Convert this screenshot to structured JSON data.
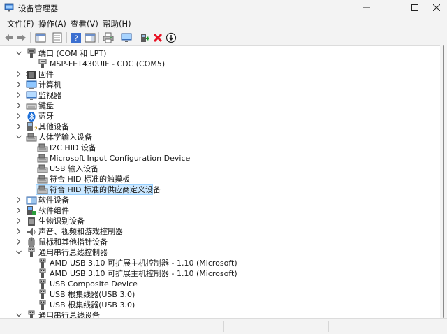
{
  "window": {
    "title": "设备管理器"
  },
  "menu": {
    "items": [
      "文件(F)",
      "操作(A)",
      "查看(V)",
      "帮助(H)"
    ]
  },
  "toolbar": {
    "buttons": [
      "back-icon",
      "forward-icon",
      "show-hide-tree-icon",
      "properties-icon",
      "help-icon",
      "action-pane-icon",
      "print-icon",
      "monitor-icon",
      "add-driver-icon",
      "uninstall-icon",
      "update-driver-icon"
    ]
  },
  "tree": {
    "rows": [
      {
        "label": "端口 (COM 和 LPT)",
        "level": 1,
        "expander": "expanded",
        "icon": "port-icon"
      },
      {
        "label": "MSP-FET430UIF - CDC (COM5)",
        "level": 2,
        "expander": "none",
        "icon": "port-icon"
      },
      {
        "label": "固件",
        "level": 1,
        "expander": "collapsed",
        "icon": "firmware-icon"
      },
      {
        "label": "计算机",
        "level": 1,
        "expander": "collapsed",
        "icon": "computer-icon"
      },
      {
        "label": "监视器",
        "level": 1,
        "expander": "collapsed",
        "icon": "monitor-icon"
      },
      {
        "label": "键盘",
        "level": 1,
        "expander": "collapsed",
        "icon": "keyboard-icon"
      },
      {
        "label": "蓝牙",
        "level": 1,
        "expander": "collapsed",
        "icon": "bluetooth-icon"
      },
      {
        "label": "其他设备",
        "level": 1,
        "expander": "collapsed",
        "icon": "unknown-device-icon"
      },
      {
        "label": "人体学输入设备",
        "level": 1,
        "expander": "expanded",
        "icon": "hid-icon"
      },
      {
        "label": "I2C HID 设备",
        "level": 2,
        "expander": "none",
        "icon": "hid-icon"
      },
      {
        "label": "Microsoft Input Configuration Device",
        "level": 2,
        "expander": "none",
        "icon": "hid-icon"
      },
      {
        "label": "USB 输入设备",
        "level": 2,
        "expander": "none",
        "icon": "hid-icon"
      },
      {
        "label": "符合 HID 标准的触摸板",
        "level": 2,
        "expander": "none",
        "icon": "hid-icon"
      },
      {
        "label": "符合 HID 标准的供应商定义设备",
        "level": 2,
        "expander": "none",
        "icon": "hid-icon",
        "selected": true
      },
      {
        "label": "软件设备",
        "level": 1,
        "expander": "collapsed",
        "icon": "software-device-icon"
      },
      {
        "label": "软件组件",
        "level": 1,
        "expander": "collapsed",
        "icon": "software-component-icon"
      },
      {
        "label": "生物识别设备",
        "level": 1,
        "expander": "collapsed",
        "icon": "biometric-icon"
      },
      {
        "label": "声音、视频和游戏控制器",
        "level": 1,
        "expander": "collapsed",
        "icon": "speaker-icon"
      },
      {
        "label": "鼠标和其他指针设备",
        "level": 1,
        "expander": "collapsed",
        "icon": "mouse-icon"
      },
      {
        "label": "通用串行总线控制器",
        "level": 1,
        "expander": "expanded",
        "icon": "usb-icon"
      },
      {
        "label": "AMD USB 3.10 可扩展主机控制器 - 1.10 (Microsoft)",
        "level": 2,
        "expander": "none",
        "icon": "usb-icon"
      },
      {
        "label": "AMD USB 3.10 可扩展主机控制器 - 1.10 (Microsoft)",
        "level": 2,
        "expander": "none",
        "icon": "usb-icon"
      },
      {
        "label": "USB Composite Device",
        "level": 2,
        "expander": "none",
        "icon": "usb-icon"
      },
      {
        "label": "USB 根集线器(USB 3.0)",
        "level": 2,
        "expander": "none",
        "icon": "usb-icon"
      },
      {
        "label": "USB 根集线器(USB 3.0)",
        "level": 2,
        "expander": "none",
        "icon": "usb-icon"
      },
      {
        "label": "通用串行总线设备",
        "level": 1,
        "expander": "expanded",
        "icon": "usb-icon"
      }
    ]
  },
  "colors": {
    "selection": "#cce8ff",
    "selection_border": "#99d1ff",
    "accent_blue": "#2f6fd6",
    "delete_red": "#e81123"
  }
}
